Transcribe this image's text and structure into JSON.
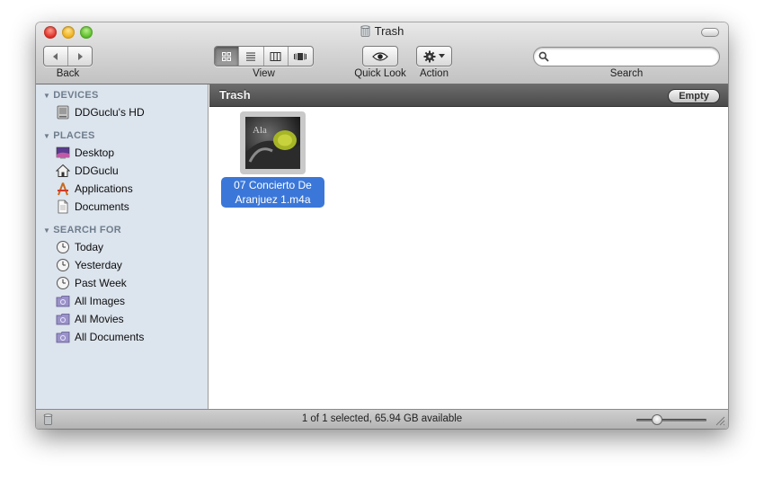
{
  "window": {
    "title": "Trash"
  },
  "toolbar": {
    "back_label": "Back",
    "view_label": "View",
    "quicklook_label": "Quick Look",
    "action_label": "Action",
    "search_label": "Search",
    "search_value": "",
    "active_view": "icon"
  },
  "sidebar": {
    "devices": {
      "header": "DEVICES",
      "items": [
        {
          "label": "DDGuclu's HD",
          "icon": "hard-drive-icon"
        }
      ]
    },
    "places": {
      "header": "PLACES",
      "items": [
        {
          "label": "Desktop",
          "icon": "desktop-icon"
        },
        {
          "label": "DDGuclu",
          "icon": "home-icon"
        },
        {
          "label": "Applications",
          "icon": "applications-icon"
        },
        {
          "label": "Documents",
          "icon": "documents-icon"
        }
      ]
    },
    "search_for": {
      "header": "SEARCH FOR",
      "items": [
        {
          "label": "Today",
          "icon": "clock-icon"
        },
        {
          "label": "Yesterday",
          "icon": "clock-icon"
        },
        {
          "label": "Past Week",
          "icon": "clock-icon"
        },
        {
          "label": "All Images",
          "icon": "smart-folder-icon"
        },
        {
          "label": "All Movies",
          "icon": "smart-folder-icon"
        },
        {
          "label": "All Documents",
          "icon": "smart-folder-icon"
        }
      ]
    }
  },
  "pathbar": {
    "title": "Trash",
    "empty_label": "Empty"
  },
  "files": [
    {
      "line1": "07 Concierto De",
      "line2": "Aranjuez 1.m4a",
      "selected": true,
      "icon": "album-art-icon"
    }
  ],
  "statusbar": {
    "text": "1 of 1 selected, 65.94 GB available",
    "zoom_level": 0.25
  },
  "colors": {
    "selection": "#3b77d8",
    "sidebar_bg": "#dce4ed",
    "section_header": "#6e7d8d"
  }
}
